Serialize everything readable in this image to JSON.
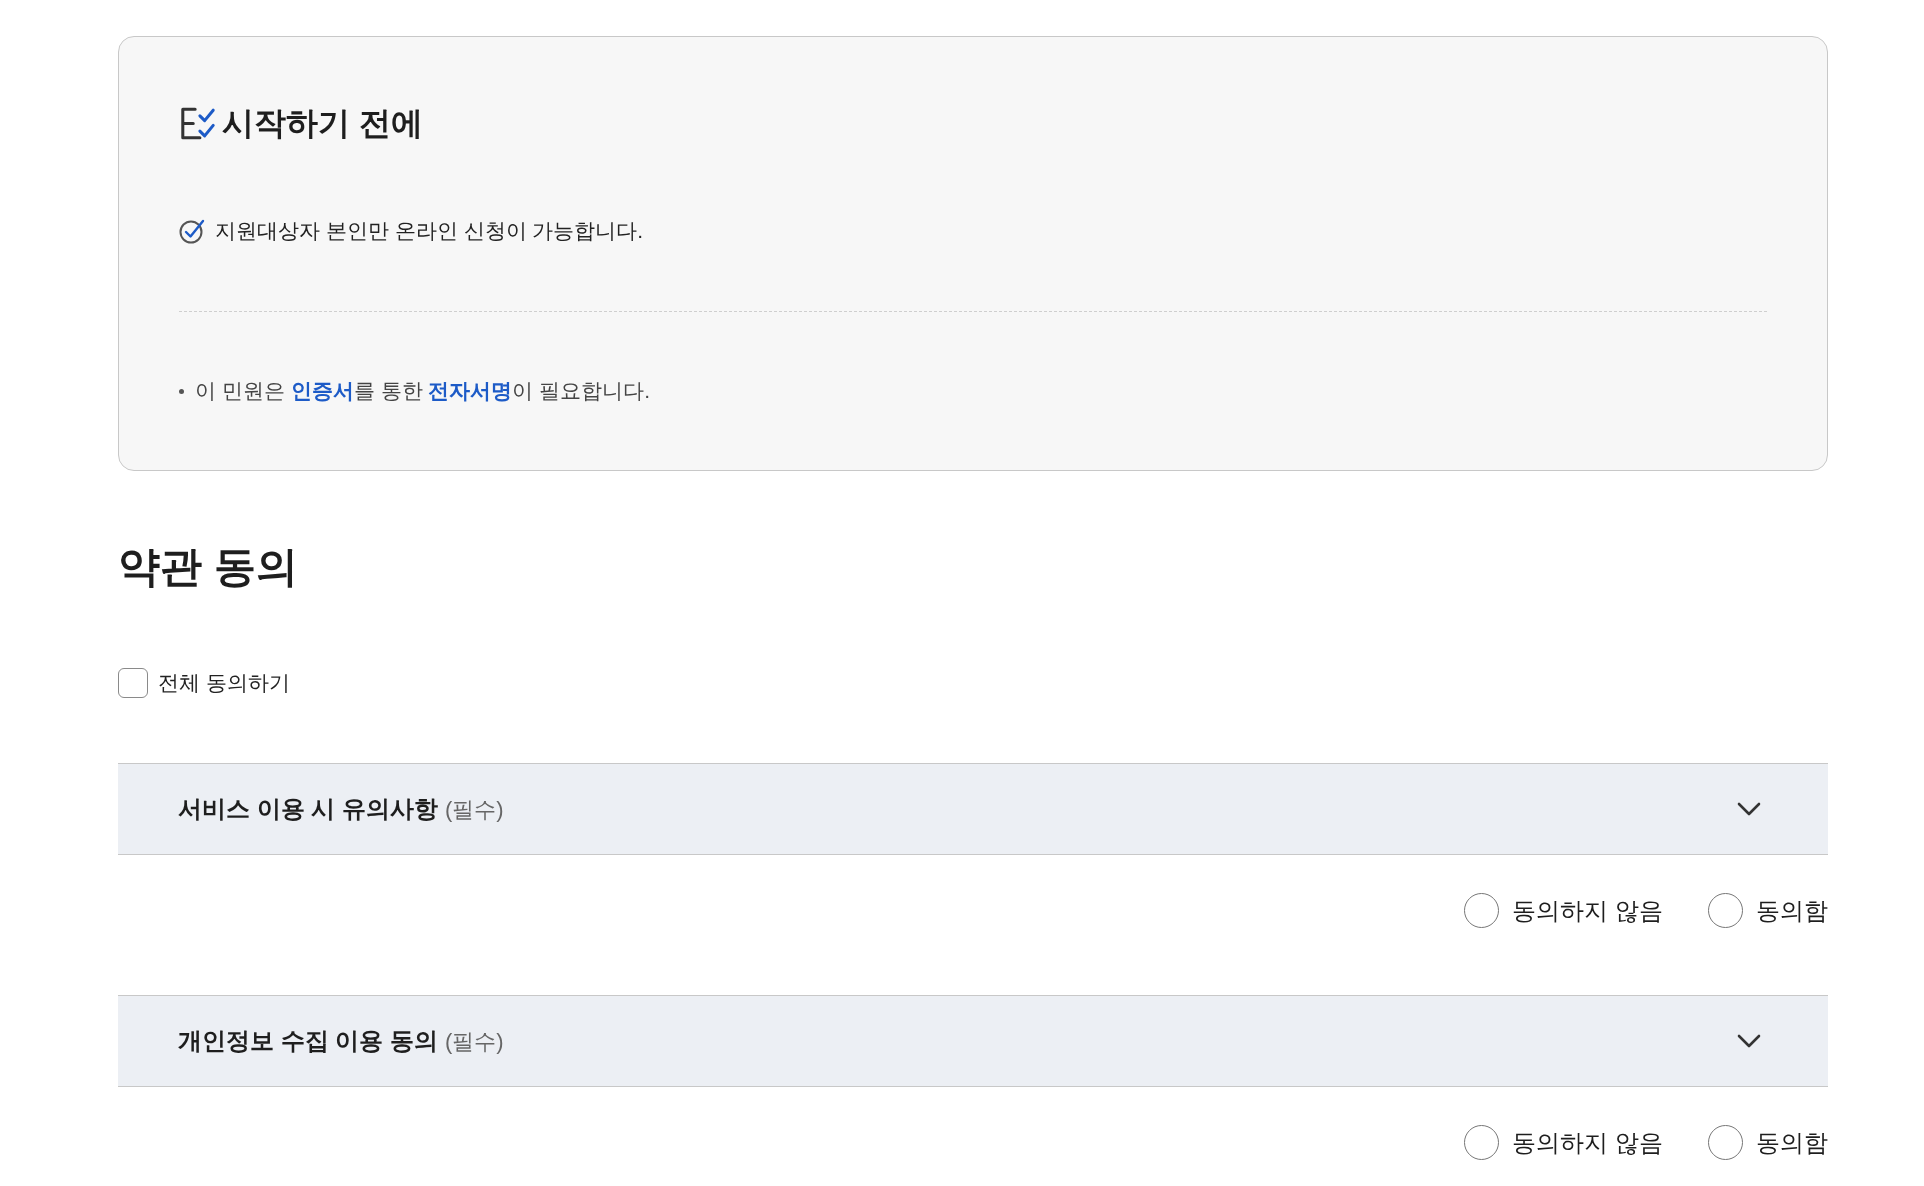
{
  "notice": {
    "title": "시작하기 전에",
    "checks": [
      "지원대상자 본인만 온라인 신청이 가능합니다."
    ],
    "bullets": [
      "이 민원은 **인증서**를 통한 **전자서명**이 필요합니다."
    ]
  },
  "terms": {
    "title": "약관 동의",
    "agree_all": {
      "label": "전체 동의하기",
      "checked": false
    },
    "sections": [
      {
        "title": "서비스 이용 시 유의사항",
        "tag": "(필수)",
        "expanded": false,
        "options": [
          {
            "label": "동의하지 않음",
            "selected": false
          },
          {
            "label": "동의함",
            "selected": false
          }
        ]
      },
      {
        "title": "개인정보 수집 이용 동의",
        "tag": "(필수)",
        "expanded": false,
        "options": [
          {
            "label": "동의하지 않음",
            "selected": false
          },
          {
            "label": "동의함",
            "selected": false
          }
        ]
      }
    ]
  }
}
